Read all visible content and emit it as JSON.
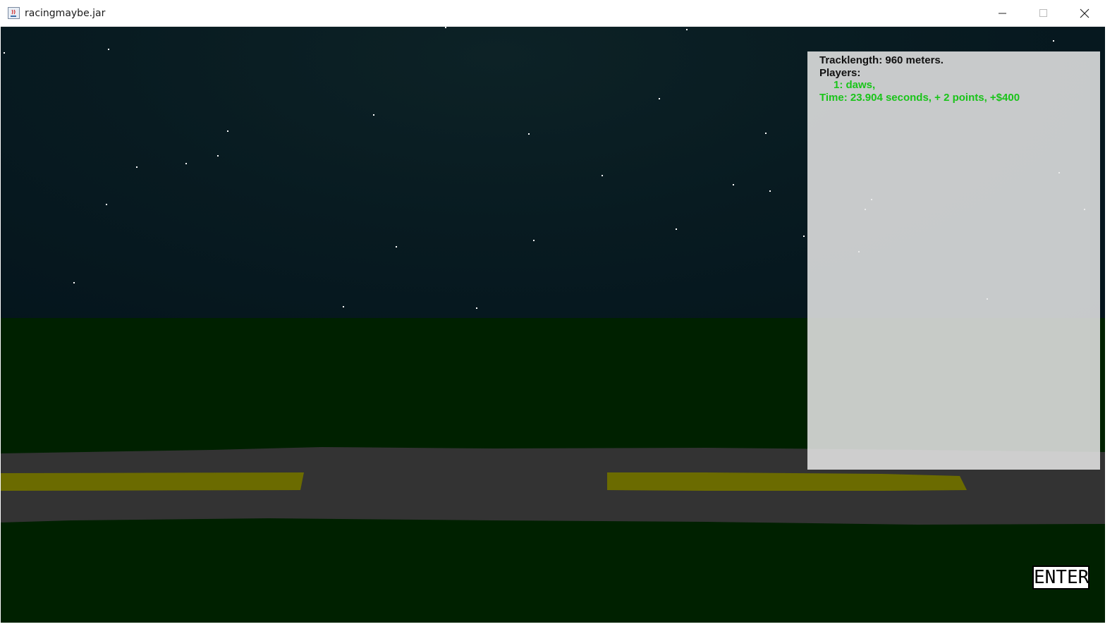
{
  "window": {
    "title": "racingmaybe.jar"
  },
  "game": {
    "info": {
      "track_length": "Tracklength: 960 meters.",
      "players_label": "Players:",
      "player_entry": "1: daws,",
      "result": "Time: 23.904 seconds, + 2 points, +$400"
    },
    "enter_label": "ENTER"
  },
  "colors": {
    "sky": "#04141c",
    "grass": "#002100",
    "road": "#333333",
    "road_stripe": "#6b6b00",
    "info_panel": "#e8e8e8",
    "info_text": "#111111",
    "highlight_text": "#19c419"
  },
  "icons": [
    "java-app-icon",
    "minimize-icon",
    "maximize-icon",
    "close-icon"
  ]
}
